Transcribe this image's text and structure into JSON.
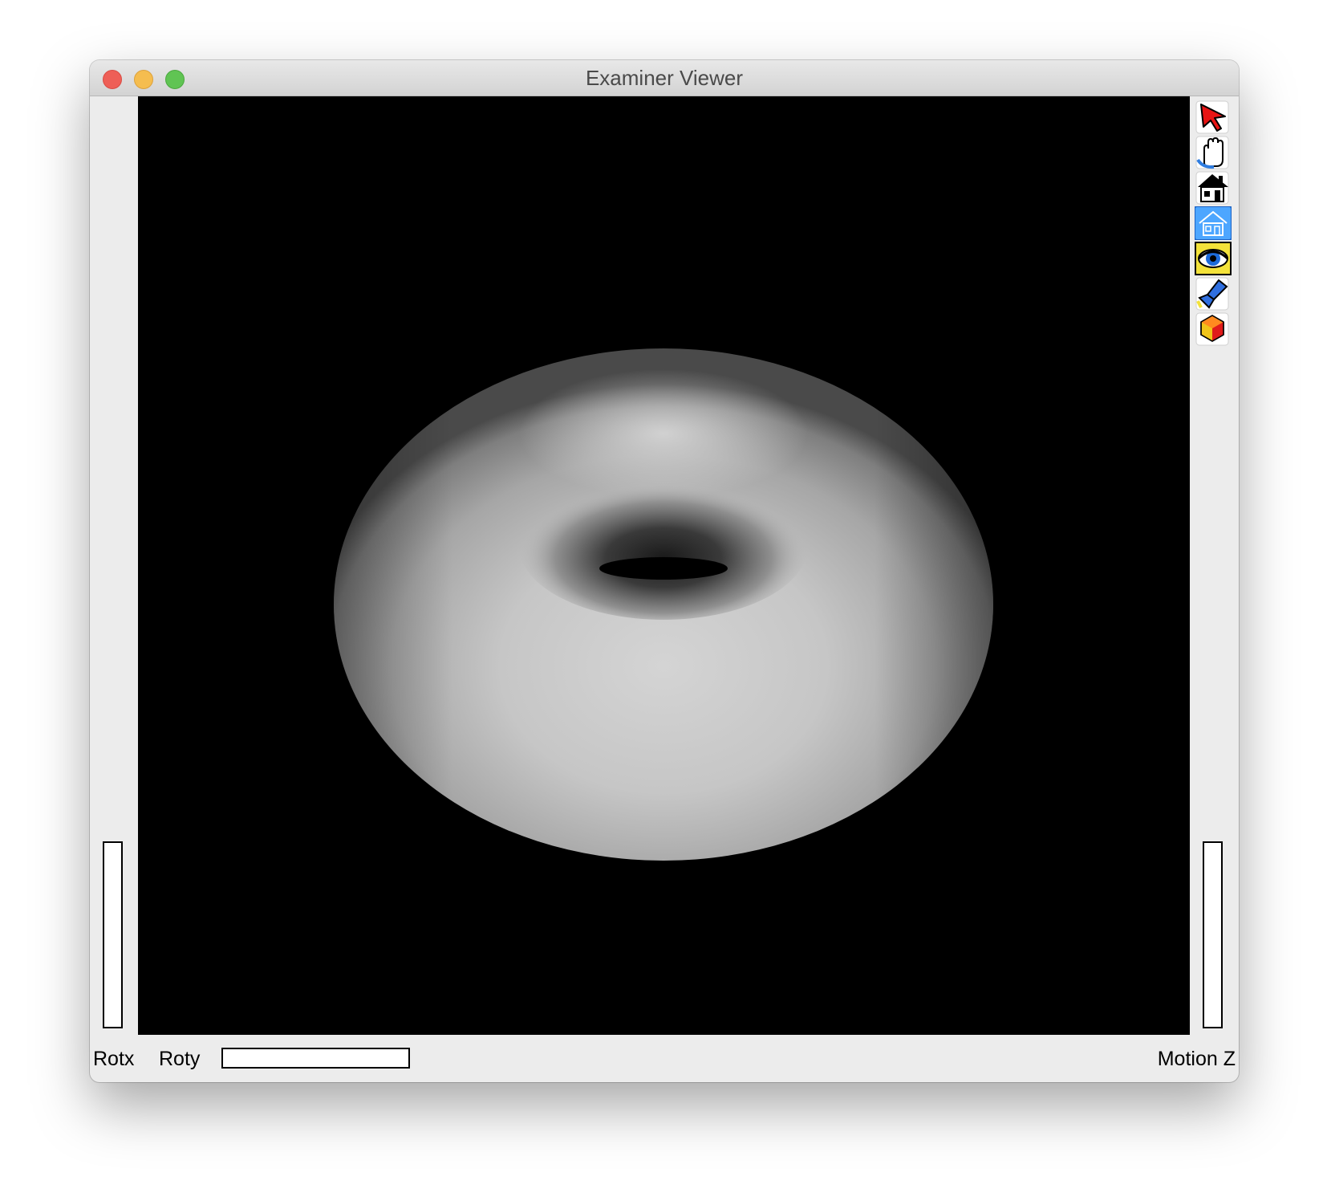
{
  "window": {
    "title": "Examiner Viewer"
  },
  "controls": {
    "rotx_label": "Rotx",
    "roty_label": "Roty",
    "motion_label": "Motion Z"
  },
  "toolbar": {
    "items": [
      {
        "name": "select-arrow-icon",
        "active": false
      },
      {
        "name": "hand-view-icon",
        "active": false
      },
      {
        "name": "home-icon",
        "active": false
      },
      {
        "name": "set-home-icon",
        "active": true
      },
      {
        "name": "view-all-icon",
        "active": false
      },
      {
        "name": "seek-flashlight-icon",
        "active": false
      },
      {
        "name": "projection-cube-icon",
        "active": false
      }
    ]
  },
  "colors": {
    "viewport_background": "#000000",
    "window_background": "#ececec",
    "active_tool": "#4da6ff"
  }
}
